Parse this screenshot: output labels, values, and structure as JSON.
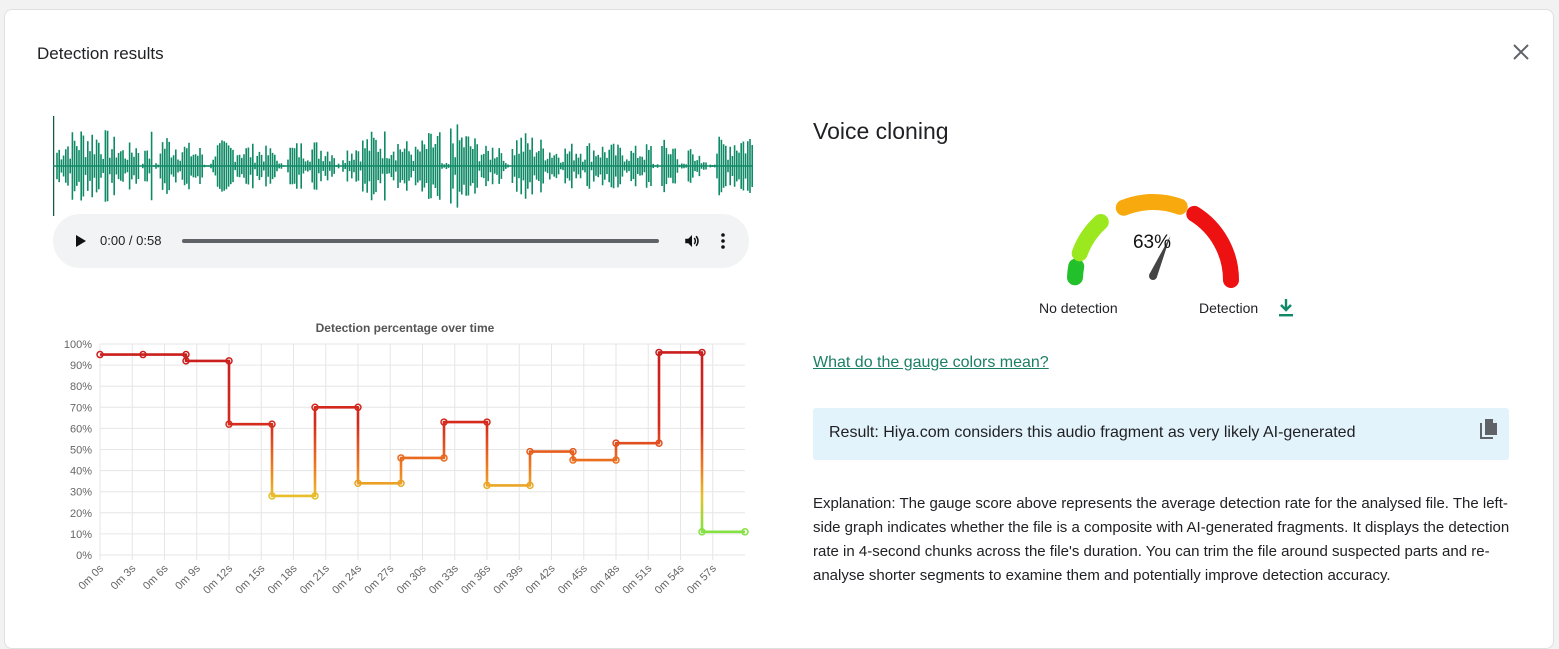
{
  "dialog": {
    "title": "Detection results",
    "close_icon": "close-icon"
  },
  "player": {
    "time": "0:00 / 0:58",
    "progress": 0,
    "icons": [
      "play-icon",
      "volume-icon",
      "more-vert-icon"
    ]
  },
  "waveform": {
    "color": "#0f8a66"
  },
  "gauge": {
    "title": "Voice cloning",
    "value_label": "63%",
    "value": 63,
    "label_left": "No detection",
    "label_right": "Detection",
    "download_icon": "download-icon",
    "segment_colors": [
      "#22c02a",
      "#9be81e",
      "#f7a90d",
      "#ee1111"
    ]
  },
  "link": {
    "text": "What do the gauge colors mean?"
  },
  "result": {
    "text": "Result: Hiya.com considers this audio fragment as very likely AI-generated",
    "copy_icon": "copy-icon"
  },
  "explanation": {
    "text": "Explanation: The gauge score above represents the average detection rate for the analysed file. The left-side graph indicates whether the file is a composite with AI-generated fragments. It displays the detection rate in 4-second chunks across the file's duration. You can trim the file around suspected parts and re-analyse shorter segments to examine them and potentially improve detection accuracy."
  },
  "chart_data": {
    "type": "line",
    "title": "Detection percentage over time",
    "xlabel": "",
    "ylabel": "",
    "xlim": [
      0,
      60
    ],
    "ylim": [
      0,
      100
    ],
    "x_ticks": [
      "0m 0s",
      "0m 3s",
      "0m 6s",
      "0m 9s",
      "0m 12s",
      "0m 15s",
      "0m 18s",
      "0m 21s",
      "0m 24s",
      "0m 27s",
      "0m 30s",
      "0m 33s",
      "0m 36s",
      "0m 39s",
      "0m 42s",
      "0m 45s",
      "0m 48s",
      "0m 51s",
      "0m 54s",
      "0m 57s"
    ],
    "y_ticks": [
      "0%",
      "10%",
      "20%",
      "30%",
      "40%",
      "50%",
      "60%",
      "70%",
      "80%",
      "90%",
      "100%"
    ],
    "grid": true,
    "stepped": true,
    "series": [
      {
        "points": [
          [
            0,
            95
          ],
          [
            4,
            95
          ],
          [
            8,
            95
          ],
          [
            8,
            92
          ],
          [
            12,
            92
          ],
          [
            12,
            62
          ],
          [
            16,
            62
          ],
          [
            16,
            28
          ],
          [
            20,
            28
          ],
          [
            20,
            70
          ],
          [
            24,
            70
          ],
          [
            24,
            34
          ],
          [
            28,
            34
          ],
          [
            28,
            46
          ],
          [
            32,
            46
          ],
          [
            32,
            63
          ],
          [
            36,
            63
          ],
          [
            36,
            33
          ],
          [
            40,
            33
          ],
          [
            40,
            49
          ],
          [
            44,
            49
          ],
          [
            44,
            45
          ],
          [
            48,
            45
          ],
          [
            48,
            53
          ],
          [
            52,
            53
          ],
          [
            52,
            96
          ],
          [
            56,
            96
          ],
          [
            56,
            11
          ],
          [
            60,
            11
          ]
        ],
        "markers_x": [
          0,
          4,
          8,
          12,
          16,
          20,
          24,
          28,
          32,
          36,
          40,
          44,
          48,
          52,
          56,
          60
        ]
      }
    ]
  }
}
